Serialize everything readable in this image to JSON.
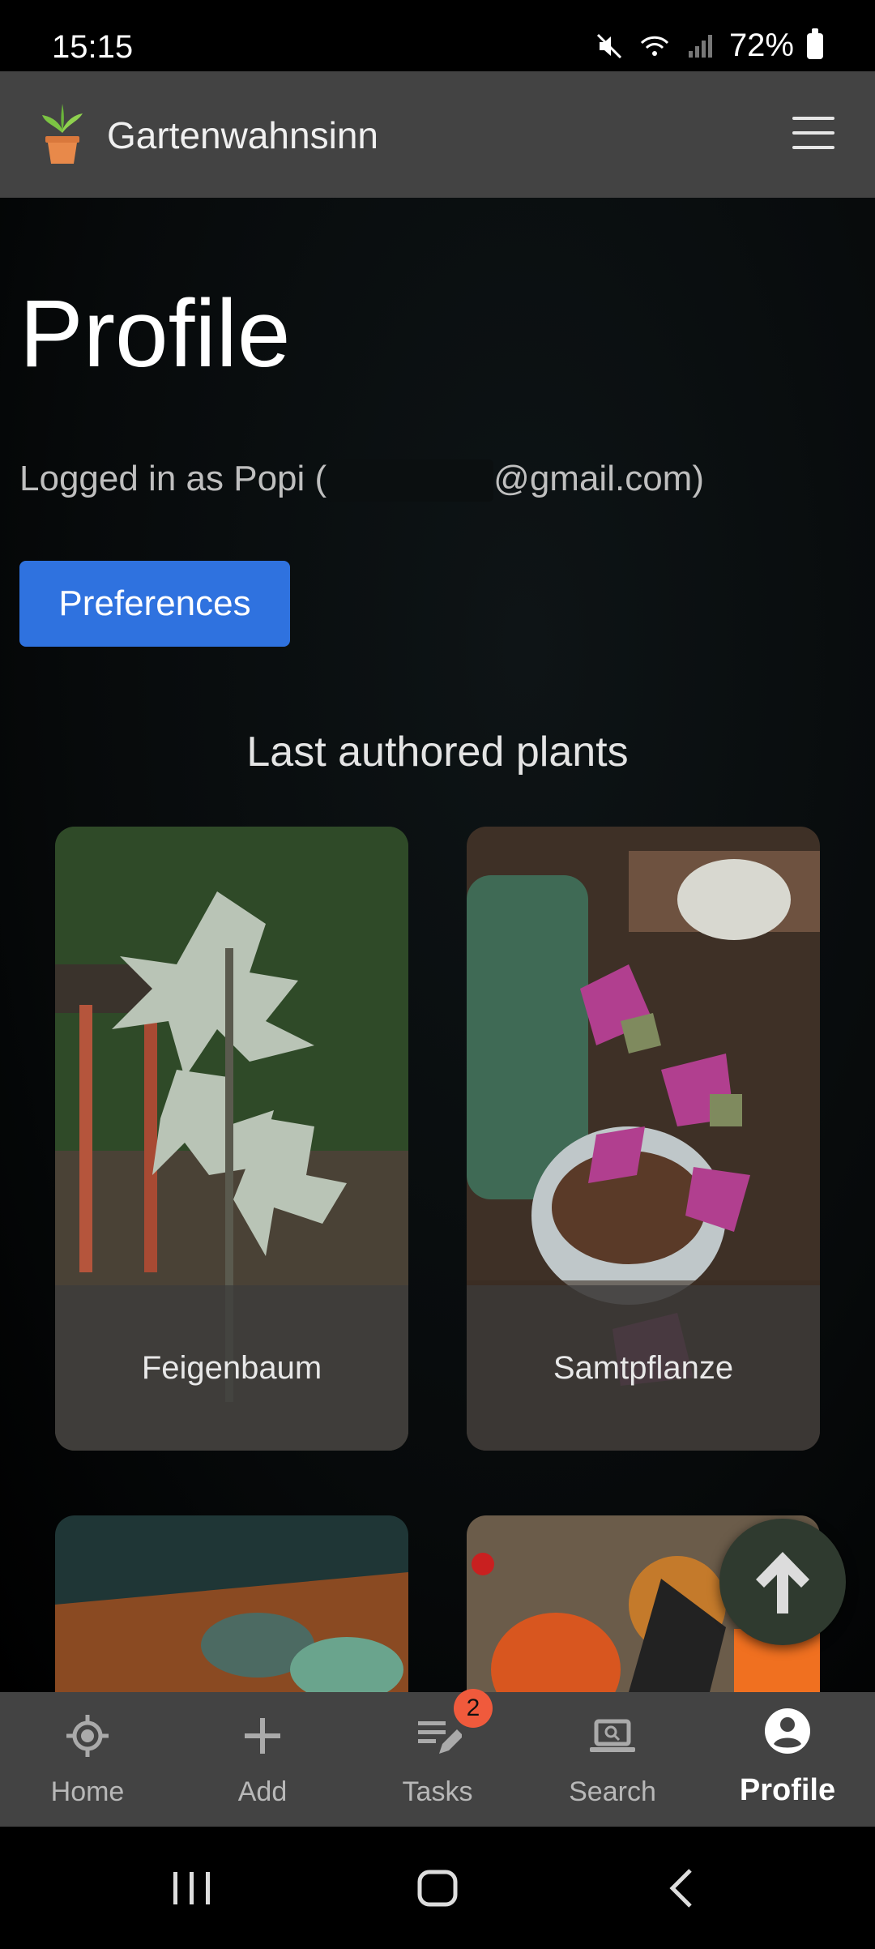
{
  "status": {
    "time": "15:15",
    "battery": "72%"
  },
  "appbar": {
    "title": "Gartenwahnsinn",
    "logo_icon": "potted-plant-icon",
    "menu_icon": "hamburger-menu-icon"
  },
  "page": {
    "title": "Profile",
    "logged_in_prefix": "Logged in as Popi (",
    "logged_in_suffix": "@gmail.com)",
    "preferences_label": "Preferences",
    "section_title": "Last authored plants"
  },
  "plants": [
    {
      "name": "Feigenbaum"
    },
    {
      "name": "Samtpflanze"
    },
    {
      "name": ""
    },
    {
      "name": ""
    }
  ],
  "bottom_nav": [
    {
      "label": "Home",
      "icon": "home-crosshair-icon"
    },
    {
      "label": "Add",
      "icon": "plus-icon"
    },
    {
      "label": "Tasks",
      "icon": "tasks-edit-icon",
      "badge": "2"
    },
    {
      "label": "Search",
      "icon": "laptop-search-icon"
    },
    {
      "label": "Profile",
      "icon": "account-circle-icon",
      "active": true
    }
  ],
  "colors": {
    "accent": "#2f72df",
    "appbar": "#434343",
    "badge": "#f05a3c",
    "fab": "#2f3a2f"
  }
}
